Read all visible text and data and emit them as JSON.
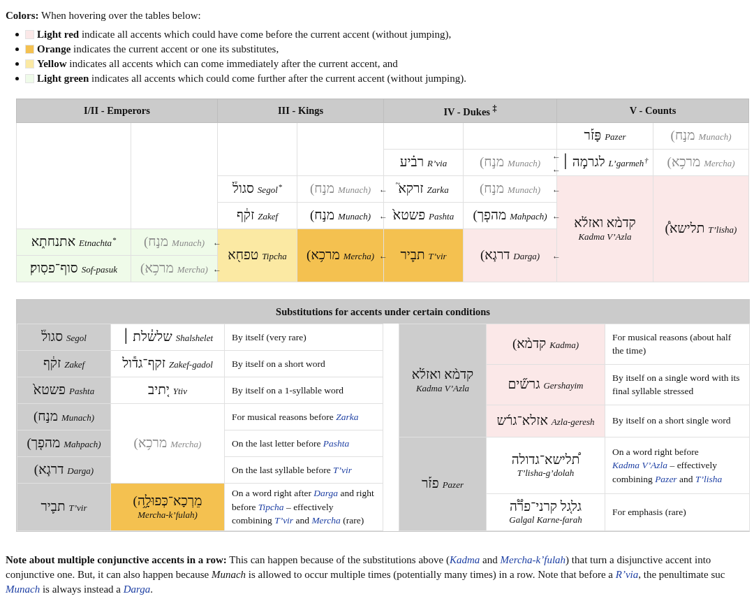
{
  "intro": "**Colors:** When hovering over the tables below:",
  "legend": [
    {
      "color": "#fbe8e8",
      "text": "**Light red** indicate all accents which could have come before the current accent (without jumping),"
    },
    {
      "color": "#f4c150",
      "text": "**Orange** indicates the current accent or one its substitutes,"
    },
    {
      "color": "#fbe9a3",
      "text": "**Yellow** indicates all accents which can come immediately after the current accent, and"
    },
    {
      "color": "#effbe9",
      "text": "**Light green** indicates all accents which could come further after the current accent (without jumping)."
    }
  ],
  "top_table": {
    "groups": [
      "I/II - Emperors",
      "III - Kings",
      "IV - Dukes $^{‡}$",
      "V - Counts"
    ],
    "rows": [
      {
        "cells": [
          {
            "kind": "empty",
            "rowspan": 5
          },
          {
            "kind": "empty",
            "rowspan": 5
          },
          {
            "kind": "empty",
            "rowspan": 3
          },
          {
            "kind": "empty",
            "rowspan": 3
          },
          {
            "kind": "empty"
          },
          {
            "kind": "empty"
          },
          {
            "kind": "inline",
            "hebrew": "פָּז֡ר",
            "name": "Pazer"
          },
          {
            "kind": "inline",
            "hebrew": "(מנ֣ח",
            "name": "Munach)",
            "muted": true
          }
        ]
      },
      {
        "cells": [
          {
            "kind": "inline",
            "hebrew": "רב֗יע",
            "name": "R’via",
            "rowspan": 2
          },
          {
            "kind": "inline",
            "hebrew": "(מנ֣ח",
            "name": "Munach)",
            "muted": true,
            "rowspan": 2,
            "arrows": [
              "←",
              "←"
            ]
          },
          {
            "kind": "inline",
            "hebrew": "לגרמ֣ה ׀",
            "name": "L’garmeh",
            "mark": "†",
            "dashed": true
          },
          {
            "kind": "inline",
            "hebrew": "(מרכ֥א",
            "name": "Mercha)",
            "muted": true,
            "dashed": true
          }
        ]
      },
      {
        "cells": [
          {
            "kind": "stacked",
            "hebrew": "קדמ֨א ואזל֜א",
            "name": "Kadma V’Azla",
            "rowspan": 5,
            "color": "#fbe8e8"
          },
          {
            "kind": "inline",
            "hebrew": "(תלישא֩",
            "name": "T’lisha)",
            "rowspan": 5,
            "color": "#fbe8e8"
          }
        ]
      },
      {
        "cells": [
          {
            "kind": "inline",
            "hebrew": "סגול֒",
            "name": "Segol",
            "mark": "*"
          },
          {
            "kind": "inline",
            "hebrew": "(מנ֣ח",
            "name": "Munach)",
            "muted": true,
            "arrows": [
              "←"
            ]
          },
          {
            "kind": "inline",
            "hebrew": "זרקא֮",
            "name": "Zarka"
          },
          {
            "kind": "inline",
            "hebrew": "(מנ֣ח",
            "name": "Munach)",
            "muted": true,
            "arrows": [
              "←"
            ]
          }
        ]
      },
      {
        "cells": [
          {
            "kind": "inline",
            "hebrew": "זק֔ף",
            "name": "Zakef"
          },
          {
            "kind": "inline",
            "hebrew": "(מנ֣ח",
            "name": "Munach)",
            "arrows": [
              "←"
            ]
          },
          {
            "kind": "inline",
            "hebrew": "פשטא֙",
            "name": "Pashta"
          },
          {
            "kind": "inline",
            "hebrew": "(מהפ֤ך",
            "name": "Mahpach)",
            "arrows": [
              "←"
            ]
          }
        ]
      },
      {
        "cells": [
          {
            "kind": "inline",
            "hebrew": "אתנחת֑א",
            "name": "Etnachta",
            "mark": "*",
            "color": "#effbe9"
          },
          {
            "kind": "inline",
            "hebrew": "(מנ֣ח",
            "name": "Munach)",
            "muted": true,
            "color": "#effbe9",
            "arrows": [
              "←"
            ]
          },
          {
            "kind": "inline",
            "hebrew": "טפח֖א",
            "name": "Tipcha",
            "rowspan": 2,
            "color": "#fbe9a3"
          },
          {
            "kind": "inline",
            "hebrew": "(מרכ֥א",
            "name": "Mercha)",
            "rowspan": 2,
            "color": "#f4c150",
            "arrows": [
              "←"
            ]
          },
          {
            "kind": "inline",
            "hebrew": "תב֛יר",
            "name": "T’vir",
            "rowspan": 2,
            "color": "#f4c150"
          },
          {
            "kind": "inline",
            "hebrew": "(דרג֧א",
            "name": "Darga)",
            "rowspan": 2,
            "color": "#fbe8e8",
            "arrows": [
              "←"
            ]
          }
        ]
      },
      {
        "cells": [
          {
            "kind": "inline",
            "hebrew": "סוף־פסֽוק׃",
            "name": "Sof-pasuk",
            "color": "#effbe9"
          },
          {
            "kind": "inline",
            "hebrew": "(מרכ֥א",
            "name": "Mercha)",
            "muted": true,
            "color": "#effbe9",
            "arrows": [
              "←"
            ]
          }
        ]
      }
    ]
  },
  "substitutions": {
    "title": "Substitutions for accents under certain conditions",
    "left": {
      "rows": [
        {
          "cells": [
            {
              "kind": "inline",
              "hebrew": "סגול֒",
              "name": "Segol",
              "color": "#cdcdcd"
            },
            {
              "kind": "inline",
              "hebrew": "שלש֓לת ׀",
              "name": "Shalshelet"
            },
            {
              "kind": "condition",
              "segments": [
                {
                  "kind": "text",
                  "text": "By itself (very rare)"
                }
              ]
            }
          ]
        },
        {
          "cells": [
            {
              "kind": "inline",
              "hebrew": "זק֔ף",
              "name": "Zakef",
              "color": "#cdcdcd"
            },
            {
              "kind": "inline",
              "hebrew": "זקף־גד֕ול",
              "name": "Zakef-gadol"
            },
            {
              "kind": "condition",
              "segments": [
                {
                  "kind": "text",
                  "text": "By itself on a short word"
                }
              ]
            }
          ]
        },
        {
          "cells": [
            {
              "kind": "inline",
              "hebrew": "פשטא֙",
              "name": "Pashta",
              "color": "#cdcdcd"
            },
            {
              "kind": "inline",
              "hebrew": "י֚תיב",
              "name": "Ytiv"
            },
            {
              "kind": "condition",
              "segments": [
                {
                  "kind": "text",
                  "text": "By itself on a 1-syllable word"
                }
              ]
            }
          ]
        },
        {
          "cells": [
            {
              "kind": "inline",
              "hebrew": "(מנ֣ח",
              "name": "Munach)",
              "color": "#cdcdcd"
            },
            {
              "kind": "inline",
              "hebrew": "(מרכ֥א",
              "name": "Mercha)",
              "muted": true,
              "rowspan": 3
            },
            {
              "kind": "condition",
              "segments": [
                {
                  "kind": "text",
                  "text": "For musical reasons before "
                },
                {
                  "kind": "link",
                  "text": "Zarka"
                }
              ]
            }
          ]
        },
        {
          "cells": [
            {
              "kind": "inline",
              "hebrew": "(מהפ֤ך",
              "name": "Mahpach)",
              "color": "#cdcdcd"
            },
            {
              "kind": "condition",
              "segments": [
                {
                  "kind": "text",
                  "text": "On the last letter before "
                },
                {
                  "kind": "link",
                  "text": "Pashta"
                }
              ]
            }
          ]
        },
        {
          "cells": [
            {
              "kind": "inline",
              "hebrew": "(דרג֧א",
              "name": "Darga)",
              "color": "#cdcdcd"
            },
            {
              "kind": "condition",
              "segments": [
                {
                  "kind": "text",
                  "text": "On the last syllable before "
                },
                {
                  "kind": "link",
                  "text": "T’vir"
                }
              ]
            }
          ]
        },
        {
          "cells": [
            {
              "kind": "inline",
              "hebrew": "תב֛יר",
              "name": "T’vir",
              "color": "#cdcdcd"
            },
            {
              "kind": "stacked",
              "hebrew": "(מֵרְכָא־כְּפוּלָ֦ה",
              "name": "Mercha-k’fulah)",
              "color": "#f4c150"
            },
            {
              "kind": "condition",
              "segments": [
                {
                  "kind": "text",
                  "text": "On a word right after "
                },
                {
                  "kind": "link",
                  "text": "Darga"
                },
                {
                  "kind": "text",
                  "text": " and right before "
                },
                {
                  "kind": "link",
                  "text": "Tipcha"
                },
                {
                  "kind": "text",
                  "text": " – effectively combining "
                },
                {
                  "kind": "link",
                  "text": "T’vir"
                },
                {
                  "kind": "text",
                  "text": " and "
                },
                {
                  "kind": "link",
                  "text": "Mercha"
                },
                {
                  "kind": "text",
                  "text": " (rare)"
                }
              ]
            }
          ]
        }
      ]
    },
    "right": {
      "rows": [
        {
          "cells": [
            {
              "kind": "stacked",
              "hebrew": "קדמ֨א ואזל֜א",
              "name": "Kadma V’Azla",
              "rowspan": 3,
              "color": "#cdcdcd"
            },
            {
              "kind": "inline",
              "hebrew": "(קדמ֨א",
              "name": "Kadma)",
              "color": "#fbe8e8"
            },
            {
              "kind": "condition",
              "segments": [
                {
                  "kind": "text",
                  "text": "For musical reasons (about half the time)"
                }
              ]
            }
          ]
        },
        {
          "cells": [
            {
              "kind": "inline",
              "hebrew": "גרש֞ים",
              "name": "Gershayim",
              "color": "#fbe8e8"
            },
            {
              "kind": "condition",
              "segments": [
                {
                  "kind": "text",
                  "text": "By itself on a single word with its final syllable stressed"
                }
              ]
            }
          ]
        },
        {
          "cells": [
            {
              "kind": "inline",
              "hebrew": "אזלא־גר֜ש",
              "name": "Azla-geresh",
              "color": "#fbe8e8"
            },
            {
              "kind": "condition",
              "segments": [
                {
                  "kind": "text",
                  "text": "By itself on a short single word"
                }
              ]
            }
          ]
        },
        {
          "cells": [
            {
              "kind": "inline",
              "hebrew": "פז֡ר",
              "name": "Pazer",
              "rowspan": 2,
              "color": "#cdcdcd"
            },
            {
              "kind": "stacked",
              "hebrew": "ת֠לישא־גדולה",
              "name": "T’lisha-g’dolah"
            },
            {
              "kind": "condition",
              "segments": [
                {
                  "kind": "text",
                  "text": "On a word right before "
                },
                {
                  "kind": "link",
                  "text": "Kadma V’Azla"
                },
                {
                  "kind": "text",
                  "text": " – effectively combining "
                },
                {
                  "kind": "link",
                  "text": "Pazer"
                },
                {
                  "kind": "text",
                  "text": " and "
                },
                {
                  "kind": "link",
                  "text": "T’lisha"
                }
              ]
            }
          ]
        },
        {
          "cells": [
            {
              "kind": "stacked",
              "hebrew": "גלג֚ל קרני־פר֟ה",
              "name": "Galgal Karne-farah"
            },
            {
              "kind": "condition",
              "segments": [
                {
                  "kind": "text",
                  "text": "For emphasis (rare)"
                }
              ]
            }
          ]
        }
      ]
    }
  },
  "note": {
    "lines": [
      [
        {
          "kind": "text",
          "text": "**Note about multiple conjunctive accents in a row:** This can happen because of the substitutions above ("
        },
        {
          "kind": "link",
          "text": "Kadma"
        },
        {
          "kind": "text",
          "text": " and "
        },
        {
          "kind": "link",
          "text": "Mercha-k’fulah"
        },
        {
          "kind": "text",
          "text": ") that turn a disjunctive accent into"
        }
      ],
      [
        {
          "kind": "text",
          "text": "conjunctive one. But, it can also happen because *Munach* is allowed to occur multiple times (potentially many times) in a row. Note that before a "
        },
        {
          "kind": "link",
          "text": "R’via"
        },
        {
          "kind": "text",
          "text": ", the penultimate suc"
        }
      ],
      [
        {
          "kind": "link",
          "text": "Munach"
        },
        {
          "kind": "text",
          "text": " is always instead a "
        },
        {
          "kind": "link",
          "text": "Darga"
        },
        {
          "kind": "text",
          "text": "."
        }
      ]
    ]
  }
}
